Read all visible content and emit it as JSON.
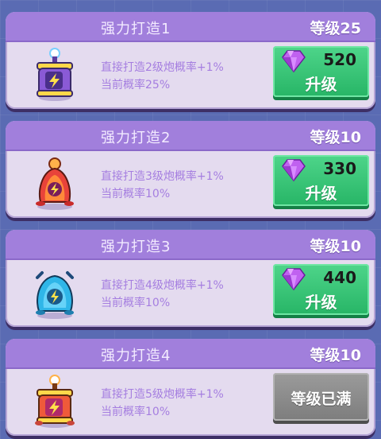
{
  "cards": [
    {
      "title": "强力打造1",
      "level": "等级25",
      "desc_1": "直接打造2级炮概率+1%",
      "desc_2": "当前概率25%",
      "price": "520",
      "button_label": "升级",
      "icon": "purple-battery-icon",
      "maxed": false
    },
    {
      "title": "强力打造2",
      "level": "等级10",
      "desc_1": "直接打造3级炮概率+1%",
      "desc_2": "当前概率10%",
      "price": "330",
      "button_label": "升级",
      "icon": "red-flame-bell-icon",
      "maxed": false
    },
    {
      "title": "强力打造3",
      "level": "等级10",
      "desc_1": "直接打造4级炮概率+1%",
      "desc_2": "当前概率10%",
      "price": "440",
      "button_label": "升级",
      "icon": "blue-crystal-orb-icon",
      "maxed": false
    },
    {
      "title": "强力打造4",
      "level": "等级10",
      "desc_1": "直接打造5级炮概率+1%",
      "desc_2": "当前概率10%",
      "button_label": "等级已满",
      "icon": "orange-gold-battery-icon",
      "maxed": true
    }
  ],
  "colors": {
    "header": "#a17fdc",
    "card_body": "#e4dbef",
    "desc_text": "#a57ee0",
    "upgrade_button": "#27b566",
    "maxed_button": "#8a8a8a",
    "gem": "#b04fe6"
  }
}
